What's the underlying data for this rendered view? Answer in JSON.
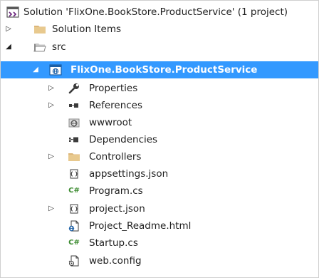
{
  "solution": {
    "label": "Solution 'FlixOne.BookStore.ProductService' (1 project)",
    "icon": "solution-icon"
  },
  "tree": {
    "solution_items": {
      "label": "Solution Items",
      "icon": "folder-icon",
      "expander": "collapsed"
    },
    "src": {
      "label": "src",
      "icon": "folder-open-icon",
      "expander": "expanded"
    },
    "project": {
      "label": "FlixOne.BookStore.ProductService",
      "icon": "web-project-icon",
      "expander": "expanded",
      "selected": true
    },
    "properties": {
      "label": "Properties",
      "icon": "wrench-icon",
      "expander": "collapsed"
    },
    "references": {
      "label": "References",
      "icon": "references-icon",
      "expander": "collapsed"
    },
    "wwwroot": {
      "label": "wwwroot",
      "icon": "globe-icon"
    },
    "dependencies": {
      "label": "Dependencies",
      "icon": "dependencies-icon"
    },
    "controllers": {
      "label": "Controllers",
      "icon": "folder-icon",
      "expander": "collapsed"
    },
    "appsettings": {
      "label": "appsettings.json",
      "icon": "json-file-icon"
    },
    "program": {
      "label": "Program.cs",
      "icon": "csharp-file-icon",
      "badge": "C#"
    },
    "projectjson": {
      "label": "project.json",
      "icon": "json-file-icon",
      "expander": "collapsed"
    },
    "readme": {
      "label": "Project_Readme.html",
      "icon": "html-file-icon"
    },
    "startup": {
      "label": "Startup.cs",
      "icon": "csharp-file-icon",
      "badge": "C#"
    },
    "webconfig": {
      "label": "web.config",
      "icon": "config-file-icon"
    }
  },
  "colors": {
    "selection": "#3399ff",
    "folder": "#dcb67a",
    "csharp": "#3a8a2e"
  }
}
